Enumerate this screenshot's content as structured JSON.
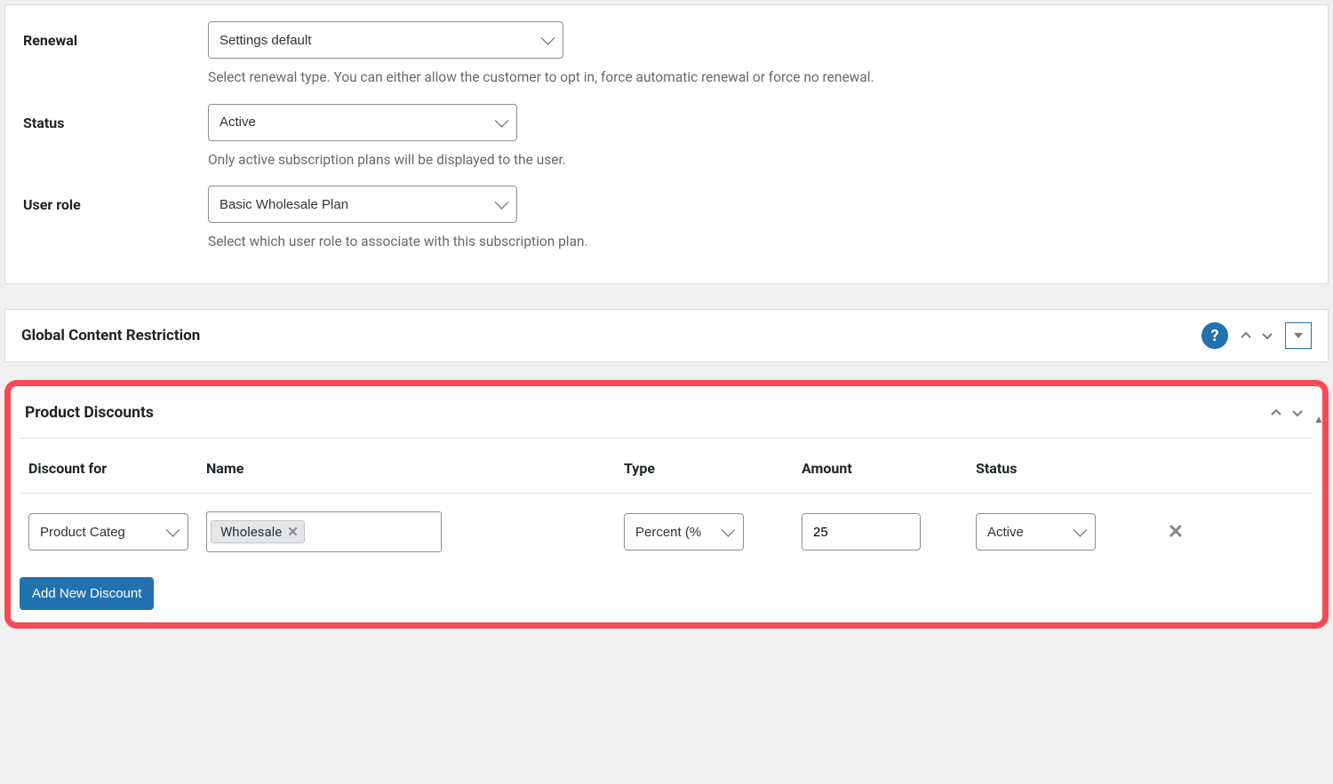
{
  "form": {
    "renewal": {
      "label": "Renewal",
      "value": "Settings default",
      "help": "Select renewal type. You can either allow the customer to opt in, force automatic renewal or force no renewal."
    },
    "status": {
      "label": "Status",
      "value": "Active",
      "help": "Only active subscription plans will be displayed to the user."
    },
    "user_role": {
      "label": "User role",
      "value": "Basic Wholesale Plan",
      "help": "Select which user role to associate with this subscription plan."
    }
  },
  "global_restriction": {
    "title": "Global Content Restriction",
    "help_icon": "?"
  },
  "product_discounts": {
    "title": "Product Discounts",
    "columns": {
      "for": "Discount for",
      "name": "Name",
      "type": "Type",
      "amount": "Amount",
      "status": "Status"
    },
    "row": {
      "for": "Product Categ",
      "tag": "Wholesale",
      "type": "Percent (%",
      "amount": "25",
      "status": "Active"
    },
    "add_button": "Add New Discount"
  }
}
